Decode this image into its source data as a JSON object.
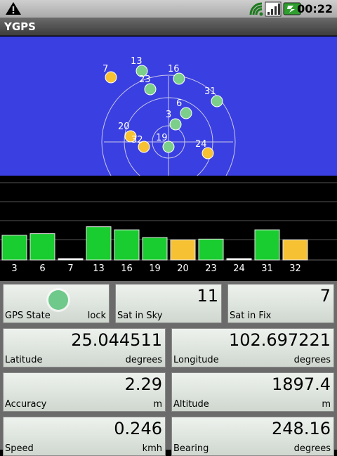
{
  "status": {
    "time": "00:22",
    "icons": [
      "alert-icon",
      "wifi-icon",
      "signal-icon",
      "battery-icon"
    ]
  },
  "app": {
    "title": "YGPS"
  },
  "sky": {
    "satellites": [
      {
        "prn": "7",
        "color": "#f6c133"
      },
      {
        "prn": "13",
        "color": "#7ccf8a"
      },
      {
        "prn": "23",
        "color": "#7ccf8a"
      },
      {
        "prn": "16",
        "color": "#7ccf8a"
      },
      {
        "prn": "31",
        "color": "#7ccf8a"
      },
      {
        "prn": "6",
        "color": "#7ccf8a"
      },
      {
        "prn": "3",
        "color": "#7ccf8a"
      },
      {
        "prn": "20",
        "color": "#f6c133"
      },
      {
        "prn": "32",
        "color": "#f6c133"
      },
      {
        "prn": "19",
        "color": "#7ccf8a"
      },
      {
        "prn": "24",
        "color": "#f6c133"
      }
    ]
  },
  "chart_data": {
    "type": "bar",
    "categories": [
      "3",
      "6",
      "7",
      "13",
      "16",
      "19",
      "20",
      "23",
      "24",
      "31",
      "32"
    ],
    "values": [
      32,
      34,
      1,
      43,
      39,
      29,
      26,
      27,
      1,
      39,
      26
    ],
    "colors": [
      "#19cc2f",
      "#19cc2f",
      "#ffffff",
      "#19cc2f",
      "#19cc2f",
      "#19cc2f",
      "#f6c133",
      "#19cc2f",
      "#ffffff",
      "#19cc2f",
      "#f6c133"
    ],
    "ylim": [
      0,
      100
    ]
  },
  "info": {
    "gps_state": {
      "label": "GPS State",
      "value": "lock"
    },
    "sat_in_sky": {
      "label": "Sat in Sky",
      "value": "11"
    },
    "sat_in_fix": {
      "label": "Sat in Fix",
      "value": "7"
    },
    "latitude": {
      "label": "Latitude",
      "value": "25.044511",
      "unit": "degrees"
    },
    "longitude": {
      "label": "Longitude",
      "value": "102.697221",
      "unit": "degrees"
    },
    "accuracy": {
      "label": "Accuracy",
      "value": "2.29",
      "unit": "m"
    },
    "altitude": {
      "label": "Altitude",
      "value": "1897.4",
      "unit": "m"
    },
    "speed": {
      "label": "Speed",
      "value": "0.246",
      "unit": "kmh"
    },
    "bearing": {
      "label": "Bearing",
      "value": "248.16",
      "unit": "degrees"
    }
  }
}
